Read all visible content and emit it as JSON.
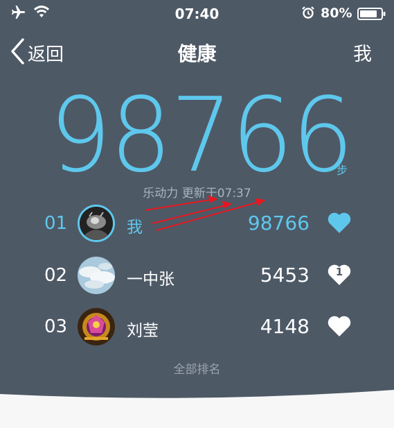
{
  "status_bar": {
    "time": "07:40",
    "battery_percent": "80%",
    "battery_level": 0.8,
    "icons": [
      "airplane-icon",
      "wifi-icon",
      "alarm-icon",
      "battery-icon"
    ]
  },
  "nav": {
    "back_label": "返回",
    "title": "健康",
    "right_label": "我"
  },
  "summary": {
    "steps": "98766",
    "unit": "步",
    "update_text": "乐动力 更新于07:37"
  },
  "ranking": [
    {
      "rank": "01",
      "name": "我",
      "steps": "98766",
      "likes": "",
      "liked": true,
      "avatar": "dark-animal-avatar"
    },
    {
      "rank": "02",
      "name": "一中张",
      "steps": "5453",
      "likes": "1",
      "liked": false,
      "avatar": "sky-clouds-avatar"
    },
    {
      "rank": "03",
      "name": "刘莹",
      "steps": "4148",
      "likes": "",
      "liked": false,
      "avatar": "game-emblem-avatar"
    }
  ],
  "footer": {
    "all_rank_label": "全部排名"
  },
  "colors": {
    "background": "#4e5966",
    "accent": "#5ec8ec",
    "text": "#ffffff",
    "annotation_arrow": "#e8161e"
  }
}
